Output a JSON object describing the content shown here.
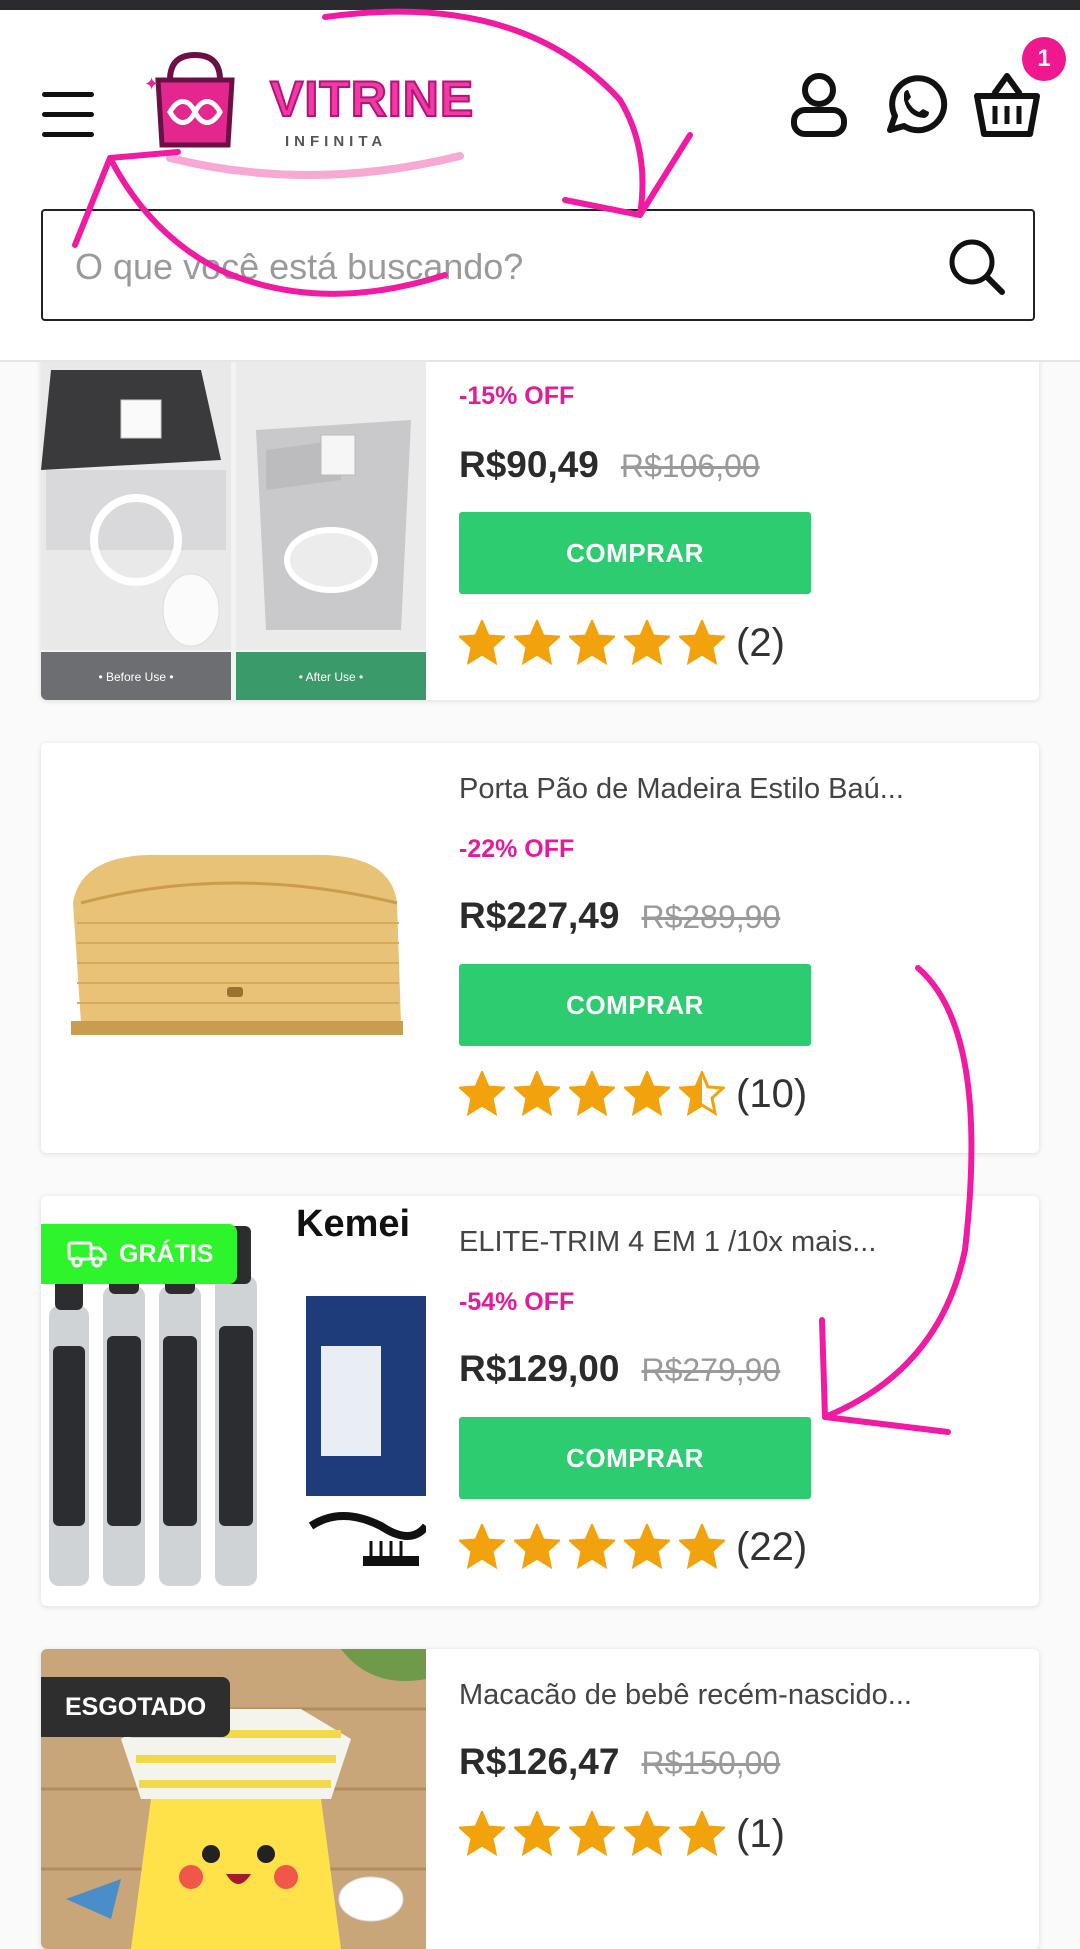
{
  "header": {
    "logo_text": "VITRINE",
    "logo_sub": "INFINITA",
    "cart_count": "1",
    "search_placeholder": "O que você está buscando?"
  },
  "products": [
    {
      "name": "",
      "discount": "-15% OFF",
      "price": "R$90,49",
      "old_price": "R$106,00",
      "button": "COMPRAR",
      "rating": 5,
      "reviews": "(2)",
      "image_labels": {
        "before": "• Before Use •",
        "after": "• After Use •"
      }
    },
    {
      "name": "Porta Pão de Madeira Estilo Baú...",
      "discount": "-22% OFF",
      "price": "R$227,49",
      "old_price": "R$289,90",
      "button": "COMPRAR",
      "rating": 4.5,
      "reviews": "(10)"
    },
    {
      "name": "ELITE-TRIM 4 EM 1 /10x mais...",
      "discount": "-54% OFF",
      "price": "R$129,00",
      "old_price": "R$279,90",
      "button": "COMPRAR",
      "rating": 5,
      "reviews": "(22)",
      "badge": "GRÁTIS",
      "brand_text": "Kemei"
    },
    {
      "name": "Macacão de bebê recém-nascido...",
      "price": "R$126,47",
      "old_price": "R$150,00",
      "rating": 5,
      "reviews": "(1)",
      "badge": "ESGOTADO"
    }
  ],
  "colors": {
    "accent_pink": "#f0188f",
    "buy_green": "#2ecc71",
    "star_gold": "#f2a20c",
    "free_badge_green": "#2ef52b"
  }
}
